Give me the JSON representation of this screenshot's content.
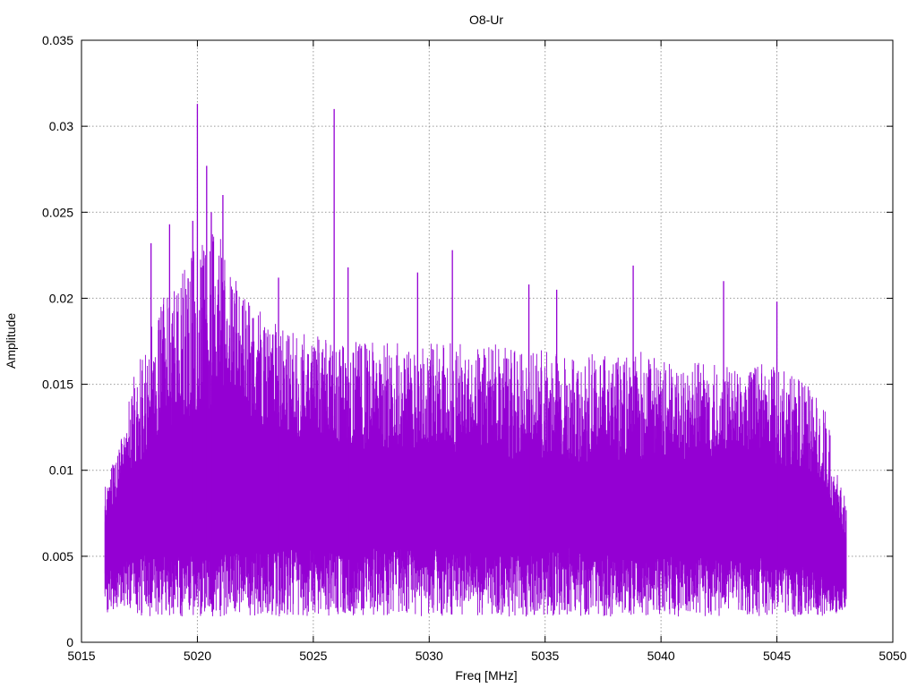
{
  "chart_data": {
    "type": "line",
    "title": "O8-Ur",
    "xlabel": "Freq [MHz]",
    "ylabel": "Amplitude",
    "xlim": [
      5015,
      5050
    ],
    "ylim": [
      0,
      0.035
    ],
    "x_ticks": [
      "5015",
      "5020",
      "5025",
      "5030",
      "5035",
      "5040",
      "5045",
      "5050"
    ],
    "y_ticks": [
      "0",
      "0.005",
      "0.01",
      "0.015",
      "0.02",
      "0.025",
      "0.03",
      "0.035"
    ],
    "x_tick_values": [
      5015,
      5020,
      5025,
      5030,
      5035,
      5040,
      5045,
      5050
    ],
    "y_tick_values": [
      0,
      0.005,
      0.01,
      0.015,
      0.02,
      0.025,
      0.03,
      0.035
    ],
    "grid": true,
    "legend": "none",
    "color": "#9400d3",
    "series": [
      {
        "x_range": [
          5016,
          5048
        ],
        "envelope": {
          "x": [
            5016,
            5016.5,
            5017,
            5017.5,
            5018,
            5018.5,
            5019,
            5019.5,
            5020,
            5020.5,
            5021,
            5021.5,
            5022,
            5023,
            5024,
            5025,
            5026,
            5027,
            5028,
            5029,
            5030,
            5031,
            5032,
            5033,
            5034,
            5035,
            5036,
            5037,
            5038,
            5039,
            5040,
            5041,
            5042,
            5043,
            5044,
            5045,
            5046,
            5047,
            5047.5,
            5048
          ],
          "lower": [
            0.0015,
            0.002,
            0.002,
            0.0015,
            0.0015,
            0.0015,
            0.0015,
            0.0015,
            0.0015,
            0.0015,
            0.0015,
            0.0015,
            0.0015,
            0.0015,
            0.0015,
            0.0015,
            0.0015,
            0.0015,
            0.0015,
            0.0015,
            0.0015,
            0.0015,
            0.0015,
            0.0015,
            0.0015,
            0.0015,
            0.0015,
            0.0015,
            0.0015,
            0.0015,
            0.0015,
            0.0015,
            0.0015,
            0.0015,
            0.0015,
            0.0015,
            0.0015,
            0.0015,
            0.0015,
            0.002
          ],
          "upper": [
            0.009,
            0.011,
            0.0145,
            0.0165,
            0.0185,
            0.02,
            0.021,
            0.022,
            0.0235,
            0.024,
            0.0235,
            0.0215,
            0.02,
            0.019,
            0.018,
            0.018,
            0.0175,
            0.0175,
            0.0175,
            0.0175,
            0.0175,
            0.0175,
            0.017,
            0.0175,
            0.017,
            0.017,
            0.0165,
            0.017,
            0.0165,
            0.017,
            0.0165,
            0.016,
            0.0165,
            0.016,
            0.016,
            0.0165,
            0.0155,
            0.014,
            0.0115,
            0.008
          ]
        },
        "dense_band": {
          "x": [
            5016,
            5017,
            5018,
            5019,
            5020,
            5021,
            5022,
            5024,
            5026,
            5028,
            5030,
            5032,
            5034,
            5036,
            5038,
            5040,
            5042,
            5044,
            5046,
            5047,
            5048
          ],
          "lower": [
            0.004,
            0.005,
            0.0055,
            0.0055,
            0.0055,
            0.0055,
            0.0055,
            0.0055,
            0.0055,
            0.0055,
            0.0055,
            0.0055,
            0.0055,
            0.0055,
            0.005,
            0.005,
            0.005,
            0.005,
            0.0045,
            0.004,
            0.003
          ],
          "upper": [
            0.007,
            0.0095,
            0.0115,
            0.0125,
            0.0135,
            0.0135,
            0.013,
            0.012,
            0.0115,
            0.011,
            0.011,
            0.011,
            0.0105,
            0.0105,
            0.0105,
            0.0105,
            0.0105,
            0.0105,
            0.01,
            0.009,
            0.006
          ]
        },
        "peaks": [
          {
            "x": 5020.0,
            "y": 0.0313
          },
          {
            "x": 5025.9,
            "y": 0.031
          },
          {
            "x": 5020.4,
            "y": 0.0277
          },
          {
            "x": 5021.1,
            "y": 0.026
          },
          {
            "x": 5020.6,
            "y": 0.025
          },
          {
            "x": 5019.8,
            "y": 0.0245
          },
          {
            "x": 5018.8,
            "y": 0.0243
          },
          {
            "x": 5018.0,
            "y": 0.0232
          },
          {
            "x": 5038.8,
            "y": 0.0219
          },
          {
            "x": 5031.0,
            "y": 0.0228
          },
          {
            "x": 5029.5,
            "y": 0.0215
          },
          {
            "x": 5042.7,
            "y": 0.021
          },
          {
            "x": 5026.5,
            "y": 0.0218
          },
          {
            "x": 5034.3,
            "y": 0.0208
          },
          {
            "x": 5045.0,
            "y": 0.0198
          },
          {
            "x": 5023.5,
            "y": 0.0212
          },
          {
            "x": 5035.5,
            "y": 0.0205
          }
        ]
      }
    ]
  }
}
